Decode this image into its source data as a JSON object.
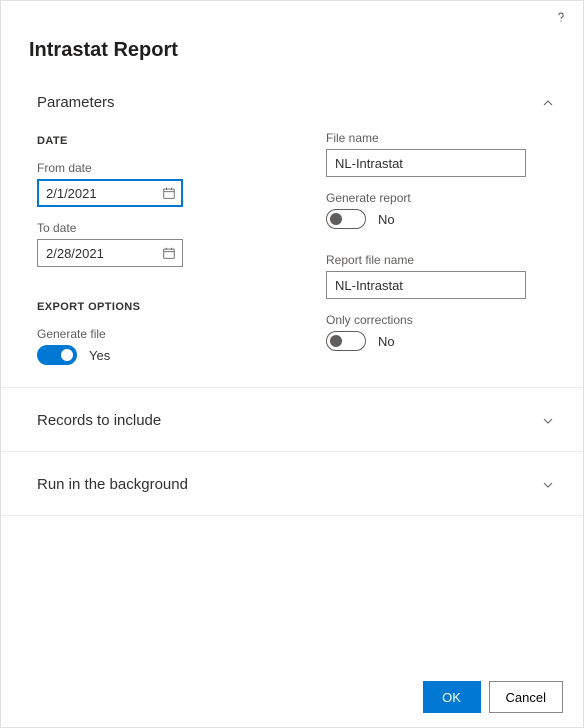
{
  "title": "Intrastat Report",
  "sections": {
    "parameters": {
      "label": "Parameters",
      "date_group": "DATE",
      "from_date_label": "From date",
      "from_date_value": "2/1/2021",
      "to_date_label": "To date",
      "to_date_value": "2/28/2021",
      "export_group": "EXPORT OPTIONS",
      "generate_file_label": "Generate file",
      "generate_file_state": "Yes",
      "file_name_label": "File name",
      "file_name_value": "NL-Intrastat",
      "generate_report_label": "Generate report",
      "generate_report_state": "No",
      "report_file_name_label": "Report file name",
      "report_file_name_value": "NL-Intrastat",
      "only_corrections_label": "Only corrections",
      "only_corrections_state": "No"
    },
    "records": {
      "label": "Records to include"
    },
    "background": {
      "label": "Run in the background"
    }
  },
  "buttons": {
    "ok": "OK",
    "cancel": "Cancel"
  }
}
